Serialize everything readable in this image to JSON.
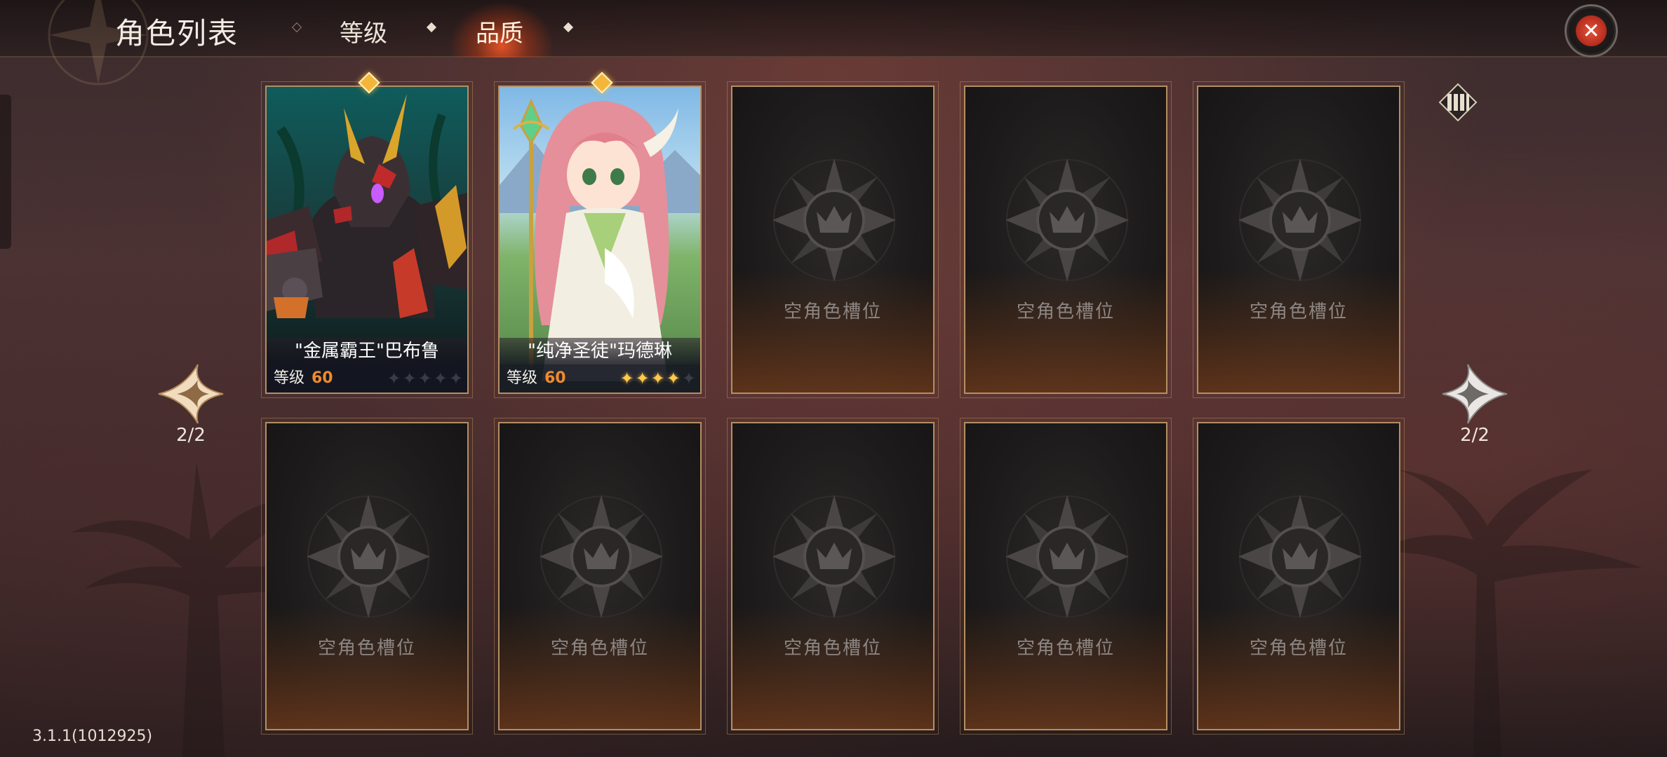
{
  "header": {
    "title": "角色列表",
    "tabs": [
      {
        "label": "等级",
        "active": false
      },
      {
        "label": "品质",
        "active": true
      }
    ]
  },
  "heroes": [
    {
      "name": "\"金属霸王\"巴布鲁",
      "level_label": "等级",
      "level": "60",
      "stars": 0,
      "max_stars": 5
    },
    {
      "name": "\"纯净圣徒\"玛德琳",
      "level_label": "等级",
      "level": "60",
      "stars": 4,
      "max_stars": 5
    }
  ],
  "empty_slot_label": "空角色槽位",
  "pagination": {
    "left": "2/2",
    "right": "2/2"
  },
  "version": "3.1.1(1012925)",
  "colors": {
    "accent_gold": "#b48f62",
    "level_orange": "#f08a2a",
    "close_red": "#e4543a",
    "star_on": "#ffc94a"
  },
  "icons": [
    "close-icon",
    "filter-columns-icon",
    "prev-page-arrow-icon",
    "next-page-arrow-icon",
    "empty-slot-crest-icon"
  ]
}
